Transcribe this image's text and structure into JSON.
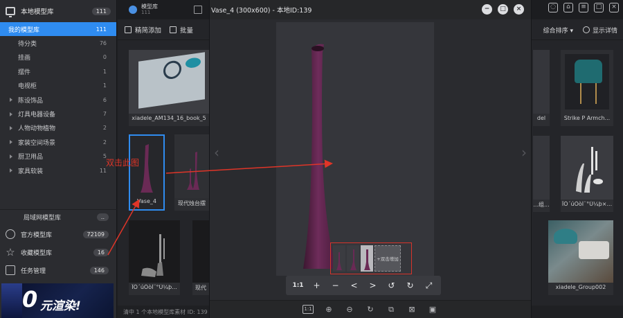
{
  "sidebar": {
    "header": {
      "title": "本地模型库",
      "count": "111"
    },
    "items": [
      {
        "label": "我的模型库",
        "count": "111",
        "active": true,
        "group": false
      },
      {
        "label": "待分类",
        "count": "76",
        "group": false
      },
      {
        "label": "挂画",
        "count": "0",
        "group": false
      },
      {
        "label": "摆件",
        "count": "1",
        "group": false
      },
      {
        "label": "电视柜",
        "count": "1",
        "group": false
      },
      {
        "label": "陈设饰品",
        "count": "6",
        "group": true
      },
      {
        "label": "灯具电器设备",
        "count": "7",
        "group": true
      },
      {
        "label": "人物动物植物",
        "count": "2",
        "group": true
      },
      {
        "label": "家装空间场景",
        "count": "2",
        "group": true
      },
      {
        "label": "厨卫用品",
        "count": "5",
        "group": true
      },
      {
        "label": "家具软装",
        "count": "11",
        "group": true
      }
    ],
    "lan": {
      "label": "局域网模型库",
      "count": ".."
    },
    "libraries": [
      {
        "label": "官方模型库",
        "count": "72109",
        "icon": "globe-icon"
      },
      {
        "label": "收藏模型库",
        "count": "16",
        "icon": "star-icon"
      },
      {
        "label": "任务管理",
        "count": "146",
        "icon": "calendar-icon"
      }
    ],
    "promo": {
      "big": "0",
      "text": "元渲染!"
    }
  },
  "tabs": [
    {
      "title": "模型库",
      "sub": "111"
    },
    {
      "title": "",
      "sub": ""
    }
  ],
  "toolbar": {
    "add_label": "精简添加",
    "batch_label": "批量",
    "sort_label": "综合排序",
    "details_label": "显示详情"
  },
  "cards": {
    "book": "xiadele_AM134_16_book_5",
    "vase": "Vase_4",
    "vases_partial": "现代烛台摆",
    "chair_partial": "del",
    "chair": "Strike P Armch...",
    "group_partial": "...组...",
    "grey_vases": "ÏÖ´úÖòÌ¨°Ú¼þ×...",
    "dark_vases": "ÏÖ´úÖòÌ¨°Ú¼þ...",
    "dark_partial": "现代",
    "group": "xiadele_Group002"
  },
  "dialog": {
    "title": "Vase_4 (300x600) - 本地ID:139",
    "add_view_label": "+双击增加",
    "controls": [
      "1:1",
      "+",
      "−",
      "<",
      ">",
      "↺",
      "↻",
      "⤢"
    ]
  },
  "annotation": {
    "text": "双击此图"
  },
  "status": {
    "text": "清中 1 个本地模型库素材 ID: 139"
  },
  "colors": {
    "accent": "#2f8cf0",
    "annotation": "#e03528",
    "vase": "#6a2a55"
  }
}
